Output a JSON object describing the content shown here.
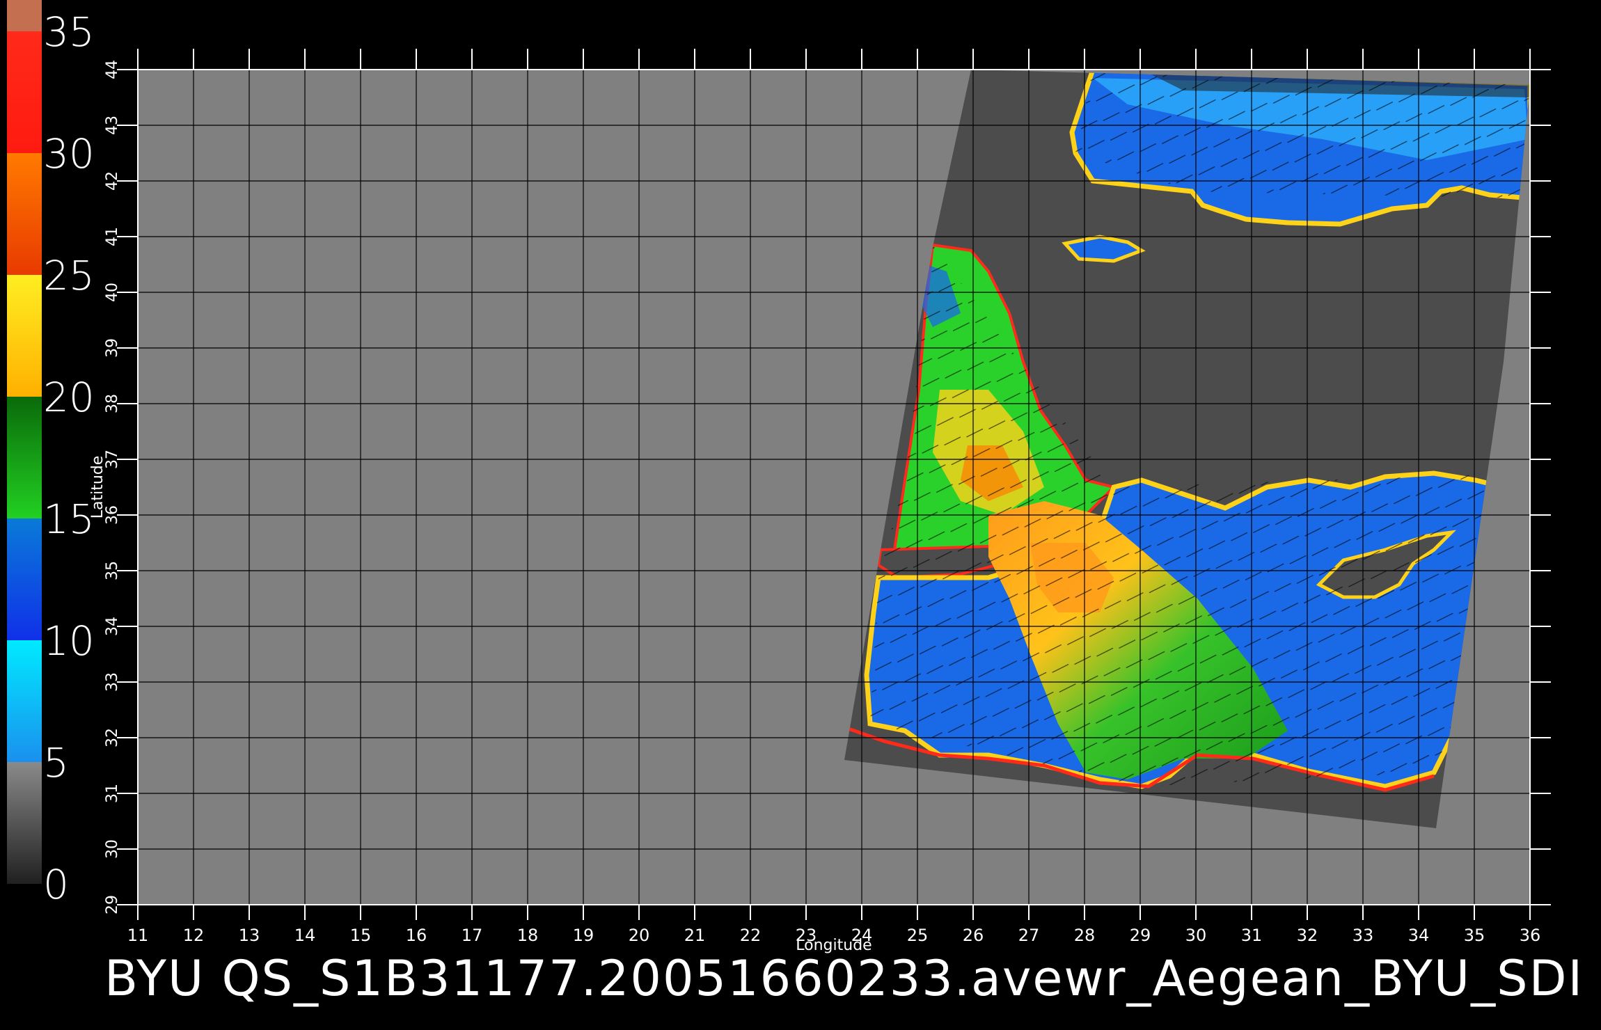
{
  "colorbar": {
    "labels": [
      "35",
      "30",
      "25",
      "20",
      "15",
      "10",
      "5",
      "0"
    ],
    "segments": [
      {
        "from": 30,
        "to": 35,
        "colors": [
          "#ff2a1a",
          "#ff1a10"
        ]
      },
      {
        "from": 25,
        "to": 30,
        "colors": [
          "#ff7a00",
          "#e83a00"
        ]
      },
      {
        "from": 20,
        "to": 25,
        "colors": [
          "#ffee22",
          "#ffb000"
        ]
      },
      {
        "from": 15,
        "to": 20,
        "colors": [
          "#0a6a0a",
          "#22d022"
        ]
      },
      {
        "from": 10,
        "to": 15,
        "colors": [
          "#0a7ad8",
          "#1030e8"
        ]
      },
      {
        "from": 5,
        "to": 10,
        "colors": [
          "#00eaff",
          "#1a90ee"
        ]
      },
      {
        "from": 0,
        "to": 5,
        "colors": [
          "#8a8a8a",
          "#202020"
        ]
      }
    ],
    "top_cap_color": "#c47050"
  },
  "map": {
    "x_ticks": [
      "11",
      "12",
      "13",
      "14",
      "15",
      "16",
      "17",
      "18",
      "19",
      "20",
      "21",
      "22",
      "23",
      "24",
      "25",
      "26",
      "27",
      "28",
      "29",
      "30",
      "31",
      "32",
      "33",
      "34",
      "35",
      "36"
    ],
    "y_ticks": [
      "29",
      "30",
      "31",
      "32",
      "33",
      "34",
      "35",
      "36",
      "37",
      "38",
      "39",
      "40",
      "41",
      "42",
      "43",
      "44"
    ],
    "xlabel": "Longitude",
    "ylabel": "Latitude",
    "lon_range": [
      11,
      36
    ],
    "lat_range": [
      29,
      44
    ],
    "colors": {
      "background_land": "#808080",
      "swath_nodata": "#4c4c4c",
      "grid": "#000000"
    }
  },
  "footer": {
    "title": "BYU  QS_S1B31177.20051660233.avewr_Aegean_BYU_SDI"
  }
}
